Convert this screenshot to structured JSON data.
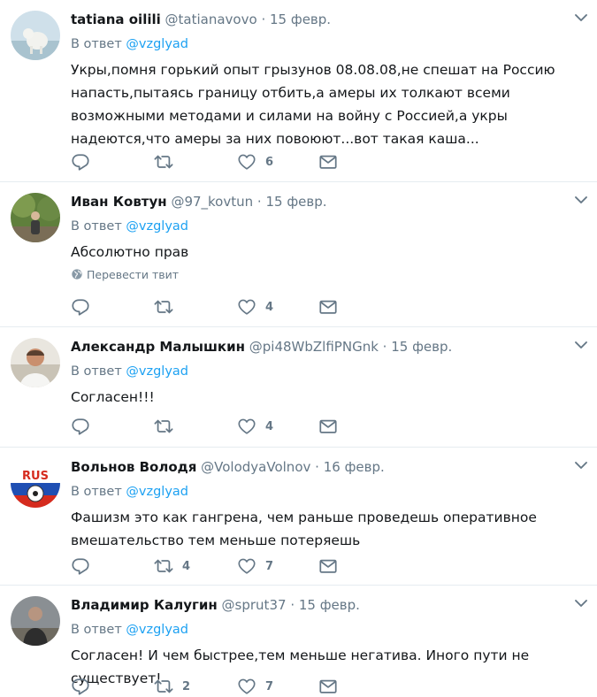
{
  "colors": {
    "accent": "#1da1f2",
    "muted": "#657786",
    "divider": "#e6ecf0"
  },
  "icons": {
    "reply": "reply-icon",
    "retweet": "retweet-icon",
    "like": "heart-icon",
    "dm": "envelope-icon",
    "menu": "chevron-down-icon",
    "translate": "globe-icon"
  },
  "reply_prefix": "В ответ",
  "tweets": [
    {
      "name": "tatiana oilili",
      "handle": "@tatianavovo",
      "date": "15 февр.",
      "reply_to": "@vzglyad",
      "text": "Укры,помня горький опыт грызунов 08.08.08,не спешат на Россию напасть,пытаясь границу отбить,а амеры их толкают всеми возможными методами и силами на войну с Россией,а укры надеются,что амеры за них повоюют...вот такая каша...",
      "retweets": "",
      "likes": "6"
    },
    {
      "name": "Иван Ковтун",
      "handle": "@97_kovtun",
      "date": "15 февр.",
      "reply_to": "@vzglyad",
      "text": "Абсолютно прав",
      "translate": "Перевести твит",
      "retweets": "",
      "likes": "4"
    },
    {
      "name": "Александр Малышкин",
      "handle": "@pi48WbZlfiPNGnk",
      "date": "15 февр.",
      "reply_to": "@vzglyad",
      "text": "Согласен!!!",
      "retweets": "",
      "likes": "4"
    },
    {
      "name": "Вольнов Володя",
      "handle": "@VolodyaVolnov",
      "date": "16 февр.",
      "reply_to": "@vzglyad",
      "text": "Фашизм это как гангрена, чем раньше проведешь оперативное вмешательство тем меньше потеряешь",
      "retweets": "4",
      "likes": "7",
      "avatar_text": "RUS"
    },
    {
      "name": "Владимир Калугин",
      "handle": "@sprut37",
      "date": "15 февр.",
      "reply_to": "@vzglyad",
      "text": "Согласен! И чем быстрее,тем меньше  негатива. Иного пути не существует!",
      "retweets": "2",
      "likes": "7"
    }
  ]
}
